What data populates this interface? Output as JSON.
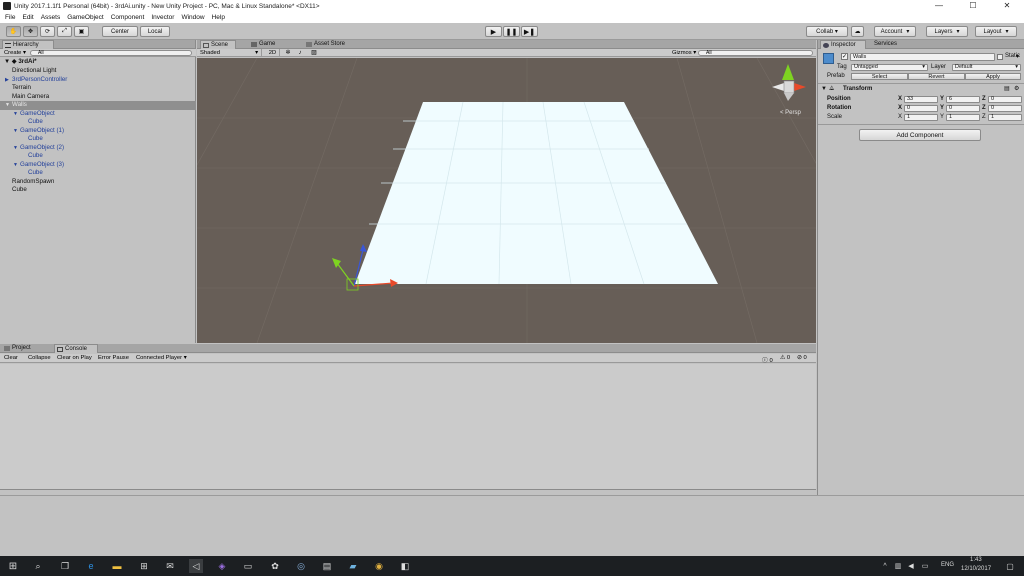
{
  "window": {
    "title": "Unity 2017.1.1f1 Personal (64bit) - 3rdAi.unity - New Unity Project - PC, Mac & Linux Standalone* <DX11>",
    "minimize": "—",
    "maximize": "☐",
    "close": "✕"
  },
  "menu": [
    "File",
    "Edit",
    "Assets",
    "GameObject",
    "Component",
    "Invector",
    "Window",
    "Help"
  ],
  "toolbar": {
    "pivot_center": "Center",
    "pivot_local": "Local",
    "collab": "Collab ▾",
    "account": "Account",
    "layers": "Layers",
    "layout": "Layout"
  },
  "hierarchy": {
    "tab": "Hierarchy",
    "create": "Create ▾",
    "search_placeholder": "All",
    "scene_name": "3rdAi*",
    "items": [
      {
        "label": "Directional Light",
        "indent": 1
      },
      {
        "label": "3rdPersonController",
        "indent": 1,
        "expander": "▶"
      },
      {
        "label": "Terrain",
        "indent": 1
      },
      {
        "label": "Main Camera",
        "indent": 1
      },
      {
        "label": "Walls",
        "indent": 1,
        "expander": "▼",
        "selected": true
      },
      {
        "label": "GameObject",
        "indent": 2,
        "expander": "▼"
      },
      {
        "label": "Cube",
        "indent": 3
      },
      {
        "label": "GameObject (1)",
        "indent": 2,
        "expander": "▼"
      },
      {
        "label": "Cube",
        "indent": 3
      },
      {
        "label": "GameObject (2)",
        "indent": 2,
        "expander": "▼"
      },
      {
        "label": "Cube",
        "indent": 3
      },
      {
        "label": "GameObject (3)",
        "indent": 2,
        "expander": "▼"
      },
      {
        "label": "Cube",
        "indent": 3
      },
      {
        "label": "RandomSpawn",
        "indent": 1
      },
      {
        "label": "Cube",
        "indent": 1
      }
    ]
  },
  "scene_tabs": [
    "Scene",
    "Game",
    "Asset Store"
  ],
  "scene_toolbar": {
    "shading": "Shaded",
    "mode_2d": "2D",
    "gizmos": "Gizmos ▾",
    "search_placeholder": "All",
    "persp_label": "< Persp"
  },
  "inspector": {
    "tabs": [
      "Inspector",
      "Services"
    ],
    "object_name": "Walls",
    "static_label": "Static",
    "tag_label": "Tag",
    "tag_value": "Untagged",
    "layer_label": "Layer",
    "layer_value": "Default",
    "prefab_label": "Prefab",
    "prefab_select": "Select",
    "prefab_revert": "Revert",
    "prefab_apply": "Apply",
    "transform_title": "Transform",
    "position": {
      "label": "Position",
      "x": "33",
      "y": "6",
      "z": "0"
    },
    "rotation": {
      "label": "Rotation",
      "x": "0",
      "y": "0",
      "z": "0"
    },
    "scale": {
      "label": "Scale",
      "x": "1",
      "y": "1",
      "z": "1"
    },
    "axis_x": "X",
    "axis_y": "Y",
    "axis_z": "Z",
    "add_component": "Add Component"
  },
  "bottom_panel": {
    "tabs": [
      "Project",
      "Console"
    ],
    "buttons": [
      "Clear",
      "Collapse",
      "Clear on Play",
      "Error Pause",
      "Connected Player ▾"
    ],
    "count_logs": "0",
    "count_warnings": "0",
    "count_errors": "0"
  },
  "taskbar": {
    "time": "1:43",
    "date": "12/10/2017",
    "language": "ENG"
  },
  "colors": {
    "scene_bg": "#675e57",
    "plane": "#f0fcff",
    "selection": "#8f8f8f",
    "blue_text": "#23409a"
  }
}
